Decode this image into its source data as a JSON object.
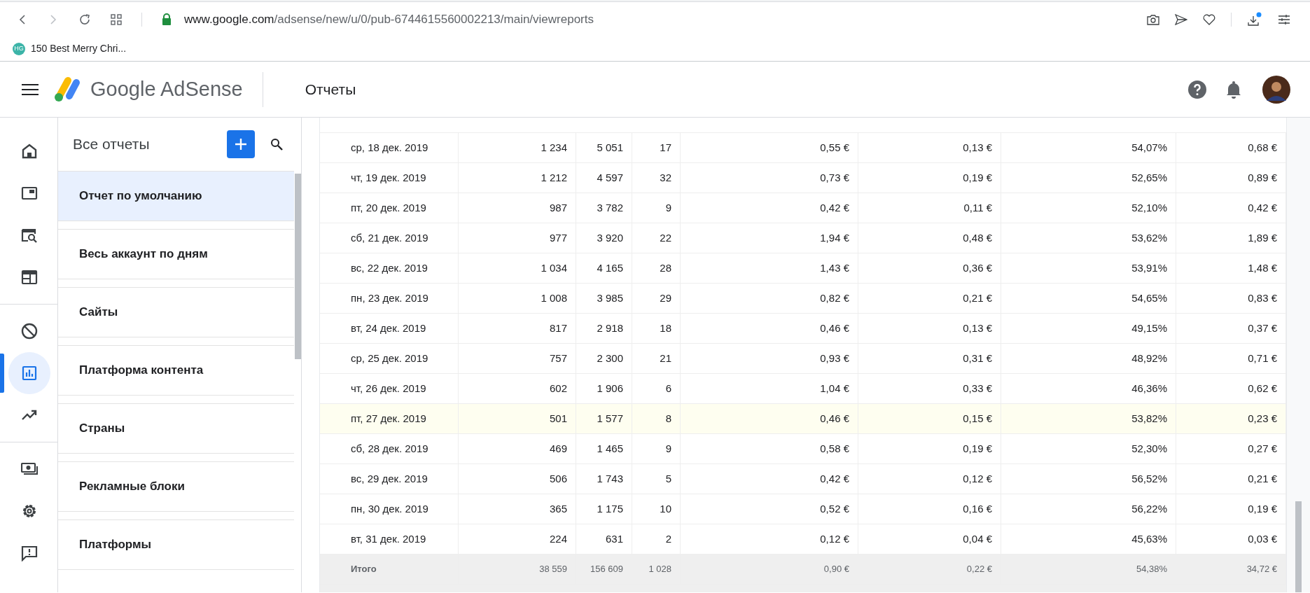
{
  "browser": {
    "url_host": "www.google.com",
    "url_path": "/adsense/new/u/0/pub-6744615560002213/main/viewreports",
    "bookmarks": [
      {
        "badge": "HG",
        "label": "150 Best Merry Chri..."
      }
    ]
  },
  "app": {
    "logo": "Google AdSense",
    "page_title": "Отчеты"
  },
  "rail": [
    [
      {
        "kind": "home",
        "selected": false
      },
      {
        "kind": "ads",
        "selected": false
      },
      {
        "kind": "site-search",
        "selected": false
      },
      {
        "kind": "layout",
        "selected": false
      }
    ],
    [
      {
        "kind": "block",
        "selected": false
      },
      {
        "kind": "reports",
        "selected": true
      },
      {
        "kind": "trend",
        "selected": false
      }
    ],
    [
      {
        "kind": "payments",
        "selected": false
      },
      {
        "kind": "settings",
        "selected": false
      },
      {
        "kind": "feedback",
        "selected": false
      }
    ]
  ],
  "reports_panel": {
    "title": "Все отчеты",
    "items": [
      {
        "label": "Отчет по умолчанию",
        "selected": true
      },
      {
        "label": "Весь аккаунт по дням",
        "selected": false
      },
      {
        "label": "Сайты",
        "selected": false
      },
      {
        "label": "Платформа контента",
        "selected": false
      },
      {
        "label": "Страны",
        "selected": false
      },
      {
        "label": "Рекламные блоки",
        "selected": false
      },
      {
        "label": "Платформы",
        "selected": false
      }
    ]
  },
  "table": {
    "rows": [
      {
        "highlighted": false,
        "cells": [
          "ср, 18 дек. 2019",
          "1 234",
          "5 051",
          "17",
          "0,55 €",
          "0,13 €",
          "54,07%",
          "0,68 €"
        ]
      },
      {
        "highlighted": false,
        "cells": [
          "чт, 19 дек. 2019",
          "1 212",
          "4 597",
          "32",
          "0,73 €",
          "0,19 €",
          "52,65%",
          "0,89 €"
        ]
      },
      {
        "highlighted": false,
        "cells": [
          "пт, 20 дек. 2019",
          "987",
          "3 782",
          "9",
          "0,42 €",
          "0,11 €",
          "52,10%",
          "0,42 €"
        ]
      },
      {
        "highlighted": false,
        "cells": [
          "сб, 21 дек. 2019",
          "977",
          "3 920",
          "22",
          "1,94 €",
          "0,48 €",
          "53,62%",
          "1,89 €"
        ]
      },
      {
        "highlighted": false,
        "cells": [
          "вс, 22 дек. 2019",
          "1 034",
          "4 165",
          "28",
          "1,43 €",
          "0,36 €",
          "53,91%",
          "1,48 €"
        ]
      },
      {
        "highlighted": false,
        "cells": [
          "пн, 23 дек. 2019",
          "1 008",
          "3 985",
          "29",
          "0,82 €",
          "0,21 €",
          "54,65%",
          "0,83 €"
        ]
      },
      {
        "highlighted": false,
        "cells": [
          "вт, 24 дек. 2019",
          "817",
          "2 918",
          "18",
          "0,46 €",
          "0,13 €",
          "49,15%",
          "0,37 €"
        ]
      },
      {
        "highlighted": false,
        "cells": [
          "ср, 25 дек. 2019",
          "757",
          "2 300",
          "21",
          "0,93 €",
          "0,31 €",
          "48,92%",
          "0,71 €"
        ]
      },
      {
        "highlighted": false,
        "cells": [
          "чт, 26 дек. 2019",
          "602",
          "1 906",
          "6",
          "1,04 €",
          "0,33 €",
          "46,36%",
          "0,62 €"
        ]
      },
      {
        "highlighted": true,
        "cells": [
          "пт, 27 дек. 2019",
          "501",
          "1 577",
          "8",
          "0,46 €",
          "0,15 €",
          "53,82%",
          "0,23 €"
        ]
      },
      {
        "highlighted": false,
        "cells": [
          "сб, 28 дек. 2019",
          "469",
          "1 465",
          "9",
          "0,58 €",
          "0,19 €",
          "52,30%",
          "0,27 €"
        ]
      },
      {
        "highlighted": false,
        "cells": [
          "вс, 29 дек. 2019",
          "506",
          "1 743",
          "5",
          "0,42 €",
          "0,12 €",
          "56,52%",
          "0,21 €"
        ]
      },
      {
        "highlighted": false,
        "cells": [
          "пн, 30 дек. 2019",
          "365",
          "1 175",
          "10",
          "0,52 €",
          "0,16 €",
          "56,22%",
          "0,19 €"
        ]
      },
      {
        "highlighted": false,
        "cells": [
          "вт, 31 дек. 2019",
          "224",
          "631",
          "2",
          "0,12 €",
          "0,04 €",
          "45,63%",
          "0,03 €"
        ]
      }
    ],
    "total": {
      "cells": [
        "Итого",
        "38 559",
        "156 609",
        "1 028",
        "0,90 €",
        "0,22 €",
        "54,38%",
        "34,72 €"
      ]
    }
  }
}
